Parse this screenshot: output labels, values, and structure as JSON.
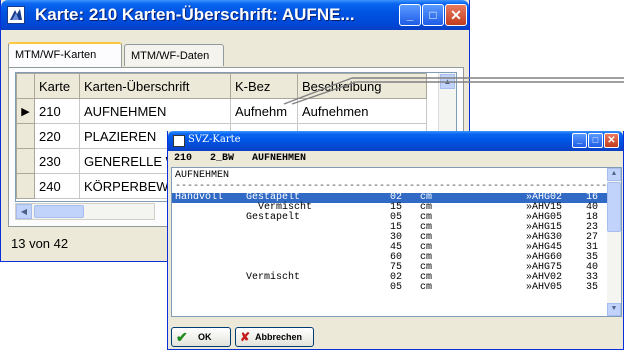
{
  "main_window": {
    "title": "Karte: 210    Karten-Überschrift: AUFNE...",
    "tabs": [
      "MTM/WF-Karten",
      "MTM/WF-Daten"
    ],
    "columns": [
      "Karte",
      "Karten-Überschrift",
      "K-Bez",
      "Beschreibung"
    ],
    "rows": [
      {
        "karte": "210",
        "ueberschrift": "AUFNEHMEN",
        "kbez": "Aufnehm",
        "beschreibung": "Aufnehmen",
        "selected": true
      },
      {
        "karte": "220",
        "ueberschrift": "PLAZIEREN",
        "kbez": "",
        "beschreibung": "",
        "selected": false
      },
      {
        "karte": "230",
        "ueberschrift": "GENERELLE W",
        "kbez": "",
        "beschreibung": "",
        "selected": false
      },
      {
        "karte": "240",
        "ueberschrift": "KÖRPERBEWE",
        "kbez": "",
        "beschreibung": "",
        "selected": false
      }
    ],
    "status": "13 von 42",
    "buttons": {
      "minimize": "_",
      "maximize": "□",
      "close": "✕"
    }
  },
  "popup": {
    "title": "SVZ-Karte",
    "header": "210   2_BW   AUFNEHMEN",
    "heading": "AUFNEHMEN",
    "separator": "--------------------------------------------------------------------------",
    "rows": [
      {
        "c1": "Handvoll",
        "c2": "Gestapelt",
        "c3": "02",
        "c4": "cm",
        "c5": "»AHG02",
        "c6": "16",
        "highlight": true
      },
      {
        "c1": "",
        "c2": "  Vermischt",
        "c3": "15",
        "c4": "cm",
        "c5": "»AHV15",
        "c6": "40",
        "highlight": false
      },
      {
        "c1": "",
        "c2": "Gestapelt",
        "c3": "05",
        "c4": "cm",
        "c5": "»AHG05",
        "c6": "18",
        "highlight": false
      },
      {
        "c1": "",
        "c2": "",
        "c3": "15",
        "c4": "cm",
        "c5": "»AHG15",
        "c6": "23",
        "highlight": false
      },
      {
        "c1": "",
        "c2": "",
        "c3": "30",
        "c4": "cm",
        "c5": "»AHG30",
        "c6": "27",
        "highlight": false
      },
      {
        "c1": "",
        "c2": "",
        "c3": "45",
        "c4": "cm",
        "c5": "»AHG45",
        "c6": "31",
        "highlight": false
      },
      {
        "c1": "",
        "c2": "",
        "c3": "60",
        "c4": "cm",
        "c5": "»AHG60",
        "c6": "35",
        "highlight": false
      },
      {
        "c1": "",
        "c2": "",
        "c3": "75",
        "c4": "cm",
        "c5": "»AHG75",
        "c6": "40",
        "highlight": false
      },
      {
        "c1": "",
        "c2": "Vermischt",
        "c3": "02",
        "c4": "cm",
        "c5": "»AHV02",
        "c6": "33",
        "highlight": false
      },
      {
        "c1": "",
        "c2": "",
        "c3": "05",
        "c4": "cm",
        "c5": "»AHV05",
        "c6": "35",
        "highlight": false
      }
    ],
    "ok_label": "OK",
    "cancel_label": "Abbrechen",
    "icons": {
      "ok": "checkmark-icon",
      "cancel": "cross-icon"
    }
  },
  "colors": {
    "titlebar": "#0054e3",
    "highlight": "#316ac5",
    "tab_accent": "#ffc83c"
  }
}
